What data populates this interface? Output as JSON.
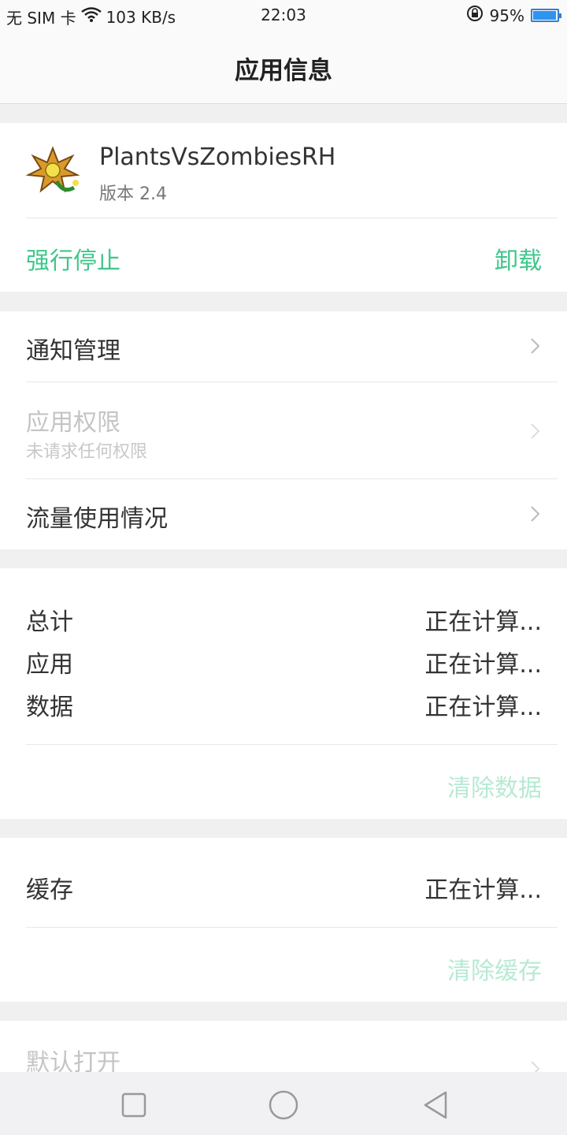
{
  "status_bar": {
    "carrier": "无 SIM 卡",
    "speed": "103 KB/s",
    "time": "22:03",
    "battery": "95%",
    "battery_level": 0.95
  },
  "header": {
    "title": "应用信息"
  },
  "app": {
    "name": "PlantsVsZombiesRH",
    "version": "版本 2.4",
    "force_stop": "强行停止",
    "uninstall": "卸载"
  },
  "settings": {
    "notification": "通知管理",
    "permissions": "应用权限",
    "permissions_sub": "未请求任何权限",
    "data_usage": "流量使用情况"
  },
  "storage": {
    "total_label": "总计",
    "total_value": "正在计算...",
    "app_label": "应用",
    "app_value": "正在计算...",
    "data_label": "数据",
    "data_value": "正在计算...",
    "clear_data": "清除数据"
  },
  "cache": {
    "label": "缓存",
    "value": "正在计算...",
    "clear_cache": "清除缓存"
  },
  "defaults": {
    "label": "默认打开"
  },
  "colors": {
    "accent": "#3ec78a",
    "accent_disabled": "#b7ead3",
    "battery": "#2f93f0"
  }
}
